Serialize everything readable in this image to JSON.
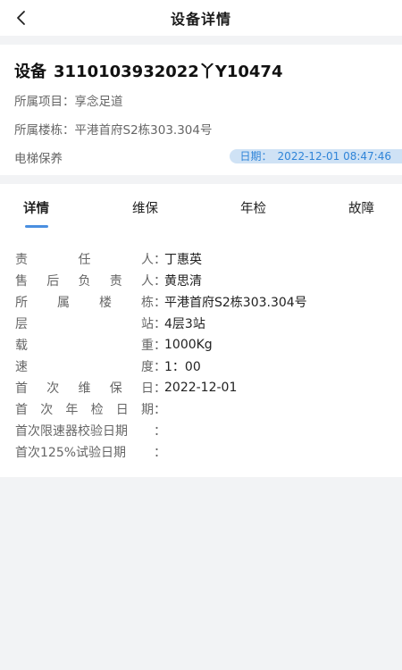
{
  "navbar": {
    "title": "设备详情",
    "back_icon": "chevron-left-icon"
  },
  "device": {
    "title_prefix": "设备",
    "code": "3110103932022丫Y10474",
    "project_label": "所属项目：",
    "project": "享念足道",
    "building_label": "所属楼栋：",
    "building": "平港首府S2栋303.304号",
    "type": "电梯保养",
    "date_label": "日期：",
    "date": "2022-12-01 08:47:46"
  },
  "tabs": [
    {
      "label": "详情",
      "active": true
    },
    {
      "label": "维保",
      "active": false
    },
    {
      "label": "年检",
      "active": false
    },
    {
      "label": "故障",
      "active": false
    }
  ],
  "fields": [
    {
      "label": "责任人",
      "value": "丁惠英"
    },
    {
      "label": "售后负责人",
      "value": "黄思清"
    },
    {
      "label": "所属楼栋",
      "value": "平港首府S2栋303.304号"
    },
    {
      "label": "层站",
      "value": "4层3站"
    },
    {
      "label": "载重",
      "value": "1000Kg"
    },
    {
      "label": "速度",
      "value": "1：00"
    },
    {
      "label": "首次维保日",
      "value": "2022-12-01"
    },
    {
      "label": "首次年检日期",
      "value": ""
    },
    {
      "label": "首次限速器校验日期",
      "value": ""
    },
    {
      "label": "首次125%试验日期",
      "value": ""
    }
  ],
  "colors": {
    "accent": "#4a8fe0",
    "date_pill_bg": "#cfe2f5",
    "date_text": "#2f84d8"
  }
}
